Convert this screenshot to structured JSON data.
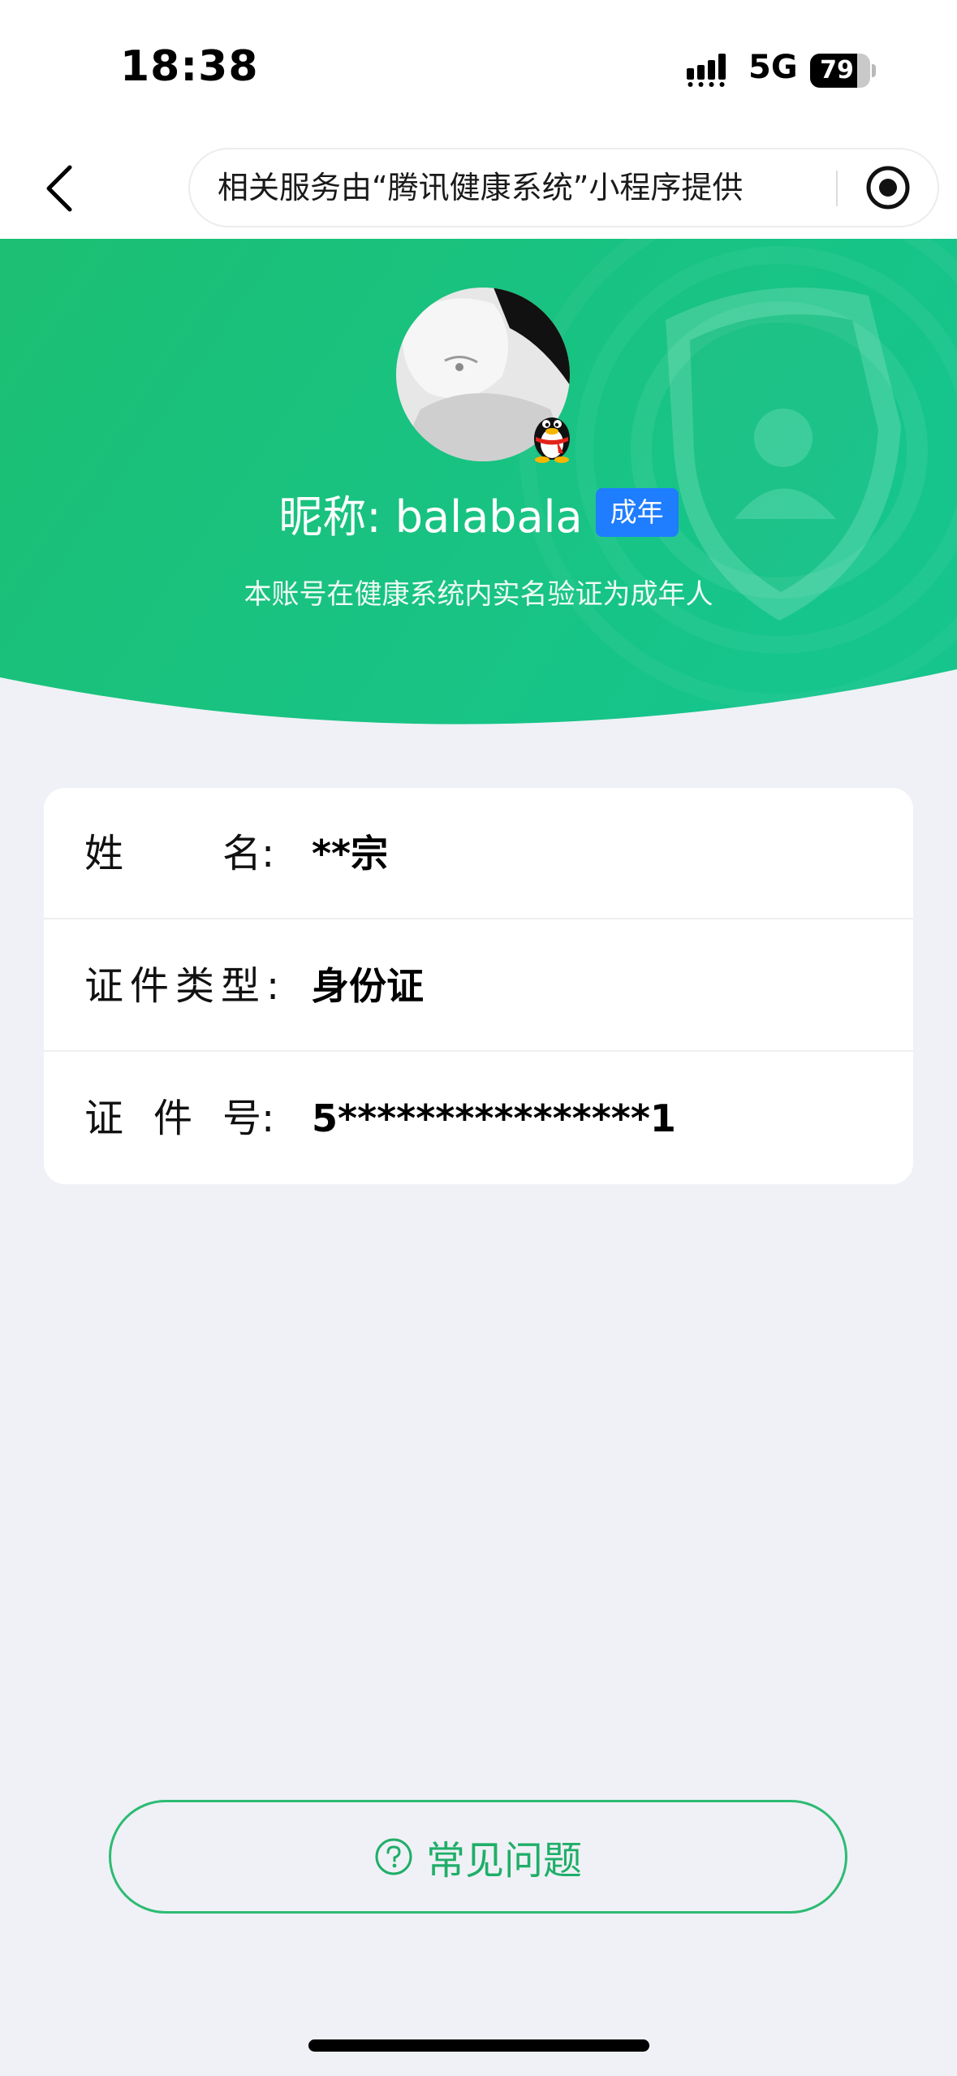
{
  "status_bar": {
    "time": "18:38",
    "network": "5G",
    "battery_level": "79",
    "battery_fraction": 0.79
  },
  "nav": {
    "provider_notice": "相关服务由“腾讯健康系统”小程序提供",
    "back_icon": "chevron-left-icon",
    "menu_icon": "record-target-icon"
  },
  "profile": {
    "nickname": "昵称: balabala",
    "age_badge": "成年",
    "verify_note": "本账号在健康系统内实名验证为成年人",
    "qq_icon": "qq-penguin-icon"
  },
  "info": {
    "name_label_chars": [
      "姓",
      "名:"
    ],
    "name_value": "**宗",
    "id_type_label": "证件类型:",
    "id_type_value": "身份证",
    "id_no_label_chars": [
      "证",
      "件",
      "号:"
    ],
    "id_no_value": "5****************1"
  },
  "faq": {
    "label": "常见问题",
    "icon": "question-circle-icon"
  },
  "colors": {
    "brand_green": "#1fc07a",
    "faq_green": "#1fae68",
    "badge_blue": "#1f7dff",
    "page_bg": "#eff1f6"
  }
}
